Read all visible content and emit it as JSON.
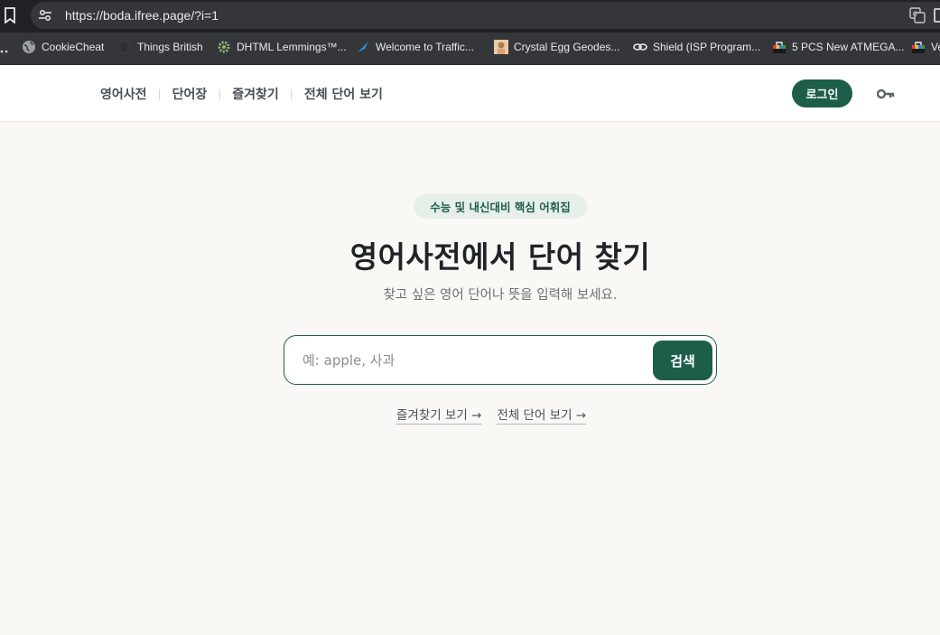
{
  "browser": {
    "url": "https://boda.ifree.page/?i=1",
    "bookmarks": [
      {
        "label": "",
        "icon": "folder-icon"
      },
      {
        "label": "CookieCheat",
        "icon": "globe-icon"
      },
      {
        "label": "Things British",
        "icon": "page-icon"
      },
      {
        "label": "DHTML Lemmings™...",
        "icon": "gear-icon"
      },
      {
        "label": "Welcome to Traffic...",
        "icon": "bird-icon"
      },
      {
        "label": "Crystal Egg Geodes...",
        "icon": "photo-icon"
      },
      {
        "label": "Shield (ISP Program...",
        "icon": "chain-icon"
      },
      {
        "label": "5 PCS New ATMEGA...",
        "icon": "store-icon"
      },
      {
        "label": "Ve",
        "icon": "store-icon"
      }
    ]
  },
  "header": {
    "nav": [
      "영어사전",
      "단어장",
      "즐겨찾기",
      "전체 단어 보기"
    ],
    "login_label": "로그인"
  },
  "hero": {
    "badge": "수능 및 내신대비 핵심 어휘집",
    "title": "영어사전에서 단어 찾기",
    "subtitle": "찾고 싶은 영어 단어나 뜻을 입력해 보세요.",
    "search": {
      "placeholder": "예: apple, 사과",
      "value": "",
      "button_label": "검색"
    },
    "links": [
      "즐겨찾기 보기 →",
      "전체 단어 보기 →"
    ]
  },
  "colors": {
    "accent": "#1d5e4a",
    "page_bg": "#f9f8f5",
    "badge_bg": "#e7efe9"
  }
}
